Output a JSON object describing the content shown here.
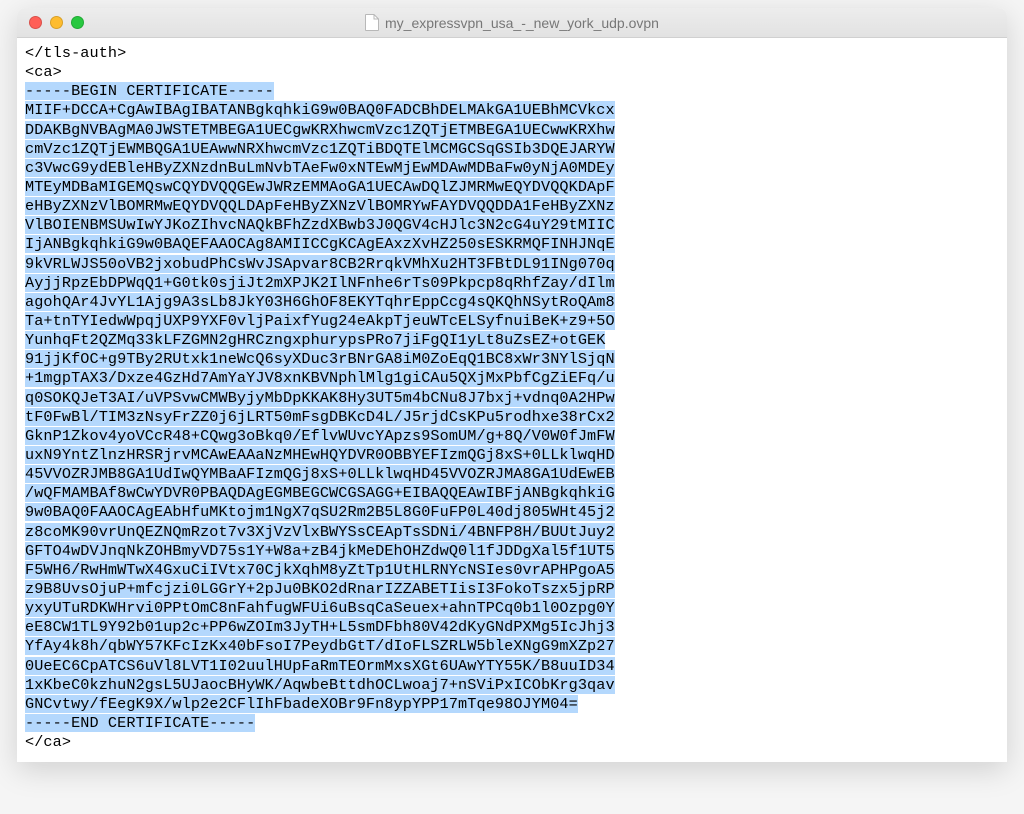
{
  "window": {
    "title": "my_expressvpn_usa_-_new_york_udp.ovpn"
  },
  "text": {
    "before_selection": "</tls-auth>\n<ca>\n",
    "selection": "-----BEGIN CERTIFICATE-----\nMIIF+DCCA+CgAwIBAgIBATANBgkqhkiG9w0BAQ0FADCBhDELMAkGA1UEBhMCVkcx\nDDAKBgNVBAgMA0JWSTETMBEGA1UECgwKRXhwcmVzc1ZQTjETMBEGA1UECwwKRXhw\ncmVzc1ZQTjEWMBQGA1UEAwwNRXhwcmVzc1ZQTiBDQTElMCMGCSqGSIb3DQEJARYW\nc3VwcG9ydEBleHByZXNzdnBuLmNvbTAeFw0xNTEwMjEwMDAwMDBaFw0yNjA0MDEy\nMTEyMDBaMIGEMQswCQYDVQQGEwJWRzEMMAoGA1UECAwDQlZJMRMwEQYDVQQKDApF\neHByZXNzVlBOMRMwEQYDVQQLDApFeHByZXNzVlBOMRYwFAYDVQQDDA1FeHByZXNz\nVlBOIENBMSUwIwYJKoZIhvcNAQkBFhZzdXBwb3J0QGV4cHJlc3N2cG4uY29tMIIC\nIjANBgkqhkiG9w0BAQEFAAOCAg8AMIICCgKCAgEAxzXvHZ250sESKRMQFINHJNqE\n9kVRLWJS50oVB2jxobudPhCsWvJSApvar8CB2RrqkVMhXu2HT3FBtDL91INg070q\nAyjjRpzEbDPWqQ1+G0tk0sjiJt2mXPJK2IlNFnhe6rTs09Pkpcp8qRhfZay/dIlm\nagohQAr4JvYL1Ajg9A3sLb8JkY03H6GhOF8EKYTqhrEppCcg4sQKQhNSytRoQAm8\nTa+tnTYIedwWpqjUXP9YXF0vljPaixfYug24eAkpTjeuWTcELSyfnuiBeK+z9+5O\nYunhqFt2QZMq33kLFZGMN2gHRCzngxphurypsPRo7jiFgQI1yLt8uZsEZ+otGEK\n91jjKfOC+g9TBy2RUtxk1neWcQ6syXDuc3rBNrGA8iM0ZoEqQ1BC8xWr3NYlSjqN\n+1mgpTAX3/Dxze4GzHd7AmYaYJV8xnKBVNphlMlg1giCAu5QXjMxPbfCgZiEFq/u\nq0SOKQJeT3AI/uVPSvwCMWByjyMbDpKKAK8Hy3UT5m4bCNu8J7bxj+vdnq0A2HPw\ntF0FwBl/TIM3zNsyFrZZ0j6jLRT50mFsgDBKcD4L/J5rjdCsKPu5rodhxe38rCx2\nGknP1Zkov4yoVCcR48+CQwg3oBkq0/EflvWUvcYApzs9SomUM/g+8Q/V0W0fJmFW\nuxN9YntZlnzHRSRjrvMCAwEAAaNzMHEwHQYDVR0OBBYEFIzmQGj8xS+0LLklwqHD\n45VVOZRJMB8GA1UdIwQYMBaAFIzmQGj8xS+0LLklwqHD45VVOZRJMA8GA1UdEwEB\n/wQFMAMBAf8wCwYDVR0PBAQDAgEGMBEGCWCGSAGG+EIBAQQEAwIBFjANBgkqhkiG\n9w0BAQ0FAAOCAgEAbHfuMKtojm1NgX7qSU2Rm2B5L8G0FuFP0L40dj805WHt45j2\nz8coMK90vrUnQEZNQmRzot7v3XjVzVlxBWYSsCEApTsSDNi/4BNFP8H/BUUtJuy2\nGFTO4wDVJnqNkZOHBmyVD75s1Y+W8a+zB4jkMeDEhOHZdwQ0l1fJDDgXal5f1UT5\nF5WH6/RwHmWTwX4GxuCiIVtx70CjkXqhM8yZtTp1UtHLRNYcNSIes0vrAPHPgoA5\nz9B8UvsOjuP+mfcjzi0LGGrY+2pJu0BKO2dRnarIZZABETIisI3FokoTszx5jpRP\nyxyUTuRDKWHrvi0PPtOmC8nFahfugWFUi6uBsqCaSeuex+ahnTPCq0b1l0Ozpg0Y\neE8CW1TL9Y92b01up2c+PP6wZOIm3JyTH+L5smDFbh80V42dKyGNdPXMg5IcJhj3\nYfAy4k8h/qbWY57KFcIzKx40bFsoI7PeydbGtT/dIoFLSZRLW5bleXNgG9mXZp27\n0UeEC6CpATCS6uVl8LVT1I02uulHUpFaRmTEOrmMxsXGt6UAwYTY55K/B8uuID34\n1xKbeC0kzhuN2gsL5UJaocBHyWK/AqwbeBttdhOCLwoaj7+nSViPxICObKrg3qav\nGNCvtwy/fEegK9X/wlp2e2CFlIhFbadeXOBr9Fn8ypYPP17mTqe98OJYM04=\n-----END CERTIFICATE-----",
    "after_selection": "\n</ca>"
  }
}
